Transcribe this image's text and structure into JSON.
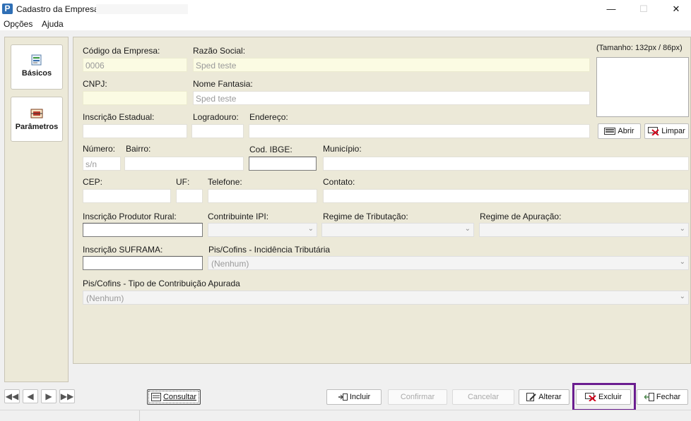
{
  "window": {
    "title": "Cadastro da Empresa",
    "app_icon": "P",
    "minimize": "—",
    "maximize": "☐",
    "close": "✕"
  },
  "menu": [
    "Opções",
    "Ajuda"
  ],
  "nav": {
    "basicos": "Básicos",
    "parametros": "Parâmetros"
  },
  "form": {
    "codigo_label": "Código da Empresa:",
    "codigo_value": "0006",
    "razao_label": "Razão Social:",
    "razao_value": "Sped teste",
    "cnpj_label": "CNPJ:",
    "fantasia_label": "Nome Fantasia:",
    "fantasia_value": "Sped teste",
    "ie_label": "Inscrição Estadual:",
    "logradouro_label": "Logradouro:",
    "endereco_label": "Endereço:",
    "numero_label": "Número:",
    "numero_value": "s/n",
    "bairro_label": "Bairro:",
    "ibge_label": "Cod. IBGE:",
    "municipio_label": "Município:",
    "cep_label": "CEP:",
    "uf_label": "UF:",
    "telefone_label": "Telefone:",
    "contato_label": "Contato:",
    "produtor_label": "Inscrição Produtor Rural:",
    "ipi_label": "Contribuinte IPI:",
    "regime_trib_label": "Regime de Tributação:",
    "regime_apur_label": "Regime de Apuração:",
    "suframa_label": "Inscrição SUFRAMA:",
    "piscofins_inc_label": "Pis/Cofins - Incidência Tributária",
    "piscofins_inc_value": "(Nenhum)",
    "piscofins_tipo_label": "Pis/Cofins - Tipo de Contribuição Apurada",
    "piscofins_tipo_value": "(Nenhum)"
  },
  "image": {
    "size_label": "(Tamanho: 132px / 86px)",
    "abrir": "Abrir",
    "limpar": "Limpar"
  },
  "bottom": {
    "consultar": "Consultar",
    "incluir": "Incluir",
    "confirmar": "Confirmar",
    "cancelar": "Cancelar",
    "alterar": "Alterar",
    "excluir": "Excluir",
    "fechar": "Fechar"
  },
  "colors": {
    "highlight": "#6a1d8f",
    "panel": "#ece9d8",
    "required_field": "#fbfbe3"
  }
}
